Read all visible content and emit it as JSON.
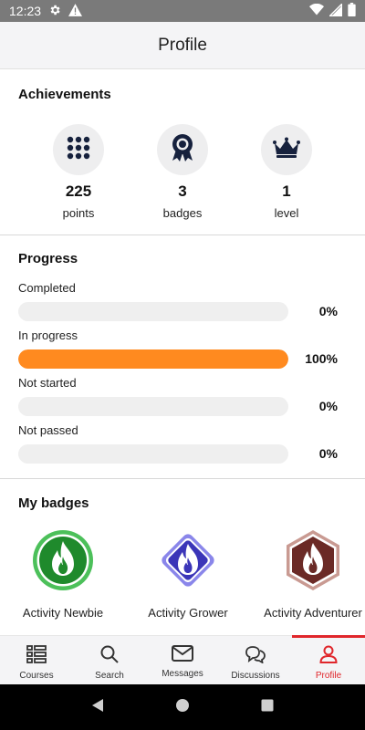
{
  "status_bar": {
    "time": "12:23"
  },
  "header": {
    "title": "Profile"
  },
  "achievements": {
    "title": "Achievements",
    "items": [
      {
        "value": "225",
        "label": "points",
        "icon": "grid-dots-icon"
      },
      {
        "value": "3",
        "label": "badges",
        "icon": "medal-icon"
      },
      {
        "value": "1",
        "label": "level",
        "icon": "crown-icon"
      }
    ]
  },
  "progress": {
    "title": "Progress",
    "rows": [
      {
        "label": "Completed",
        "percent_text": "0%",
        "fraction": 0
      },
      {
        "label": "In progress",
        "percent_text": "100%",
        "fraction": 1
      },
      {
        "label": "Not started",
        "percent_text": "0%",
        "fraction": 0
      },
      {
        "label": "Not passed",
        "percent_text": "0%",
        "fraction": 0
      }
    ],
    "bar_color": "#ff8a1f",
    "track_color": "#efefef"
  },
  "badges": {
    "title": "My badges",
    "items": [
      {
        "name": "Activity Newbie",
        "shape": "circle",
        "color": "#1f8a2c",
        "ring": "#4cc05a"
      },
      {
        "name": "Activity Grower",
        "shape": "diamond",
        "color": "#3b35b8",
        "ring": "#8a86ea"
      },
      {
        "name": "Activity Adventurer",
        "shape": "hexagon",
        "color": "#6b2a26",
        "ring": "#c99a92"
      }
    ]
  },
  "bottom_nav": {
    "accent": "#e0262b",
    "items": [
      {
        "label": "Courses",
        "icon": "courses-icon"
      },
      {
        "label": "Search",
        "icon": "search-icon"
      },
      {
        "label": "Messages",
        "icon": "envelope-icon"
      },
      {
        "label": "Discussions",
        "icon": "chat-bubbles-icon"
      },
      {
        "label": "Profile",
        "icon": "person-icon",
        "active": true
      }
    ]
  }
}
